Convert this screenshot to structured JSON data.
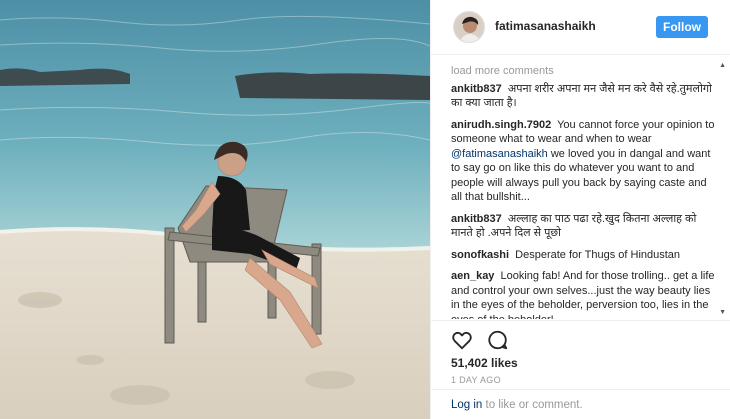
{
  "post": {
    "username": "fatimasanashaikh",
    "follow_label": "Follow",
    "load_more": "load more comments",
    "comments": [
      {
        "user": "ankitb837",
        "text": "अपना शरीर अपना मन जैसे मन करे वैसे रहे.तुमलोगो का क्या जाता है।"
      },
      {
        "user": "anirudh.singh.7902",
        "text_before": "You cannot force your opinion to someone what to wear and when to wear",
        "mention": "@fatimasanashaikh",
        "text_after": "we loved you in dangal and want to say go on like this do whatever you want to and people will always pull you back by saying caste and all that bullshit..."
      },
      {
        "user": "ankitb837",
        "text": "अल्लाह का पाठ पढा रहे.खुद कितना अल्लाह को मानते हो .अपने दिल से पूछो"
      },
      {
        "user": "sonofkashi",
        "text": "Desperate for Thugs of Hindustan"
      },
      {
        "user": "aen_kay",
        "text": "Looking fab! And for those trolling.. get a life and control your own selves...just the way beauty lies in the eyes of the beholder, perversion too, lies in the eyes of the beholder!"
      }
    ],
    "likes": "51,402 likes",
    "time": "1 DAY AGO",
    "login_link": "Log in",
    "login_rest": " to like or comment.",
    "icons": {
      "like": "heart-icon",
      "comment": "comment-bubble-icon",
      "scroll_up": "triangle-up-icon",
      "scroll_down": "triangle-down-icon"
    },
    "colors": {
      "follow": "#3897f0",
      "link": "#003569",
      "muted": "#999999"
    }
  }
}
